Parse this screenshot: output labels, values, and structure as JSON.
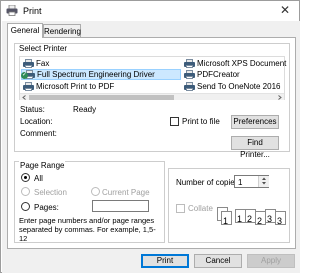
{
  "window": {
    "title": "Print",
    "close_glyph": "✕"
  },
  "tabs": [
    {
      "label": "General",
      "active": true
    },
    {
      "label": "Rendering",
      "active": false
    }
  ],
  "select_printer": {
    "label": "Select Printer",
    "printers": [
      {
        "name": "Fax",
        "icon": "printer-icon"
      },
      {
        "name": "Full Spectrum Engineering Driver",
        "icon": "printer-icon",
        "selected": true,
        "default": true
      },
      {
        "name": "Microsoft Print to PDF",
        "icon": "printer-icon"
      },
      {
        "name": "Microsoft XPS Document",
        "icon": "printer-icon"
      },
      {
        "name": "PDFCreator",
        "icon": "printer-icon"
      },
      {
        "name": "Send To OneNote 2016",
        "icon": "printer-icon"
      }
    ],
    "status_label": "Status:",
    "status_value": "Ready",
    "location_label": "Location:",
    "location_value": "",
    "comment_label": "Comment:",
    "comment_value": "",
    "print_to_file_label": "Print to file",
    "print_to_file_checked": false,
    "preferences_label": "Preferences",
    "find_printer_label": "Find Printer..."
  },
  "page_range": {
    "label": "Page Range",
    "options": {
      "all": "All",
      "selection": "Selection",
      "current_page": "Current Page",
      "pages": "Pages:"
    },
    "selected": "all",
    "pages_value": "",
    "hint": "Enter page numbers and/or page ranges separated by commas. For example, 1,5-12"
  },
  "copies": {
    "label": "Number of copies:",
    "value": "1",
    "collate_label": "Collate",
    "collate_checked": false,
    "collate_digits": [
      "1",
      "1",
      "2",
      "2",
      "3",
      "3"
    ]
  },
  "buttons": {
    "print": "Print",
    "cancel": "Cancel",
    "apply": "Apply"
  },
  "colors": {
    "accent": "#0078d7",
    "selection": "#cce8ff",
    "panel": "#f0f0f0"
  }
}
